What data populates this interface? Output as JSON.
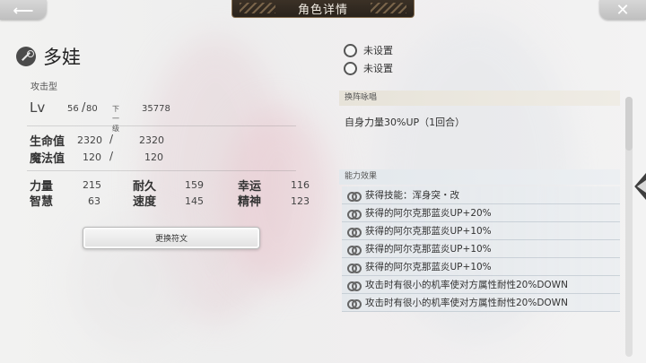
{
  "header": {
    "title": "角色详情"
  },
  "character": {
    "name": "多娃",
    "type": "攻击型",
    "level": {
      "label": "Lv",
      "current": "56",
      "slash": "/",
      "max": "80",
      "next_label": "下一级",
      "next_value": "35778"
    },
    "hp": {
      "label": "生命值",
      "current": "2320",
      "slash": "/",
      "max": "2320"
    },
    "mp": {
      "label": "魔法值",
      "current": "120",
      "slash": "/",
      "max": "120"
    },
    "stats": [
      {
        "label": "力量",
        "value": "215"
      },
      {
        "label": "耐久",
        "value": "159"
      },
      {
        "label": "幸运",
        "value": "116"
      },
      {
        "label": "智慧",
        "value": "63"
      },
      {
        "label": "速度",
        "value": "145"
      },
      {
        "label": "精神",
        "value": "123"
      }
    ]
  },
  "rune_button": {
    "label": "更换符文"
  },
  "settings": [
    {
      "label": "未设置"
    },
    {
      "label": "未设置"
    }
  ],
  "formation_chant": {
    "header": "换阵咏唱",
    "text": "自身力量30%UP（1回合）"
  },
  "abilities": {
    "header": "能力效果",
    "items": [
      "获得技能：浑身突・改",
      "获得的阿尔克那蓝炎UP+20%",
      "获得的阿尔克那蓝炎UP+10%",
      "获得的阿尔克那蓝炎UP+10%",
      "获得的阿尔克那蓝炎UP+10%",
      "攻击时有很小的机率使对方属性耐性20%DOWN",
      "攻击时有很小的机率使对方属性耐性20%DOWN"
    ]
  },
  "icons": {
    "back": "back-arrow-icon",
    "close": "close-icon",
    "class": "bow-class-icon",
    "ability": "link-icon"
  }
}
